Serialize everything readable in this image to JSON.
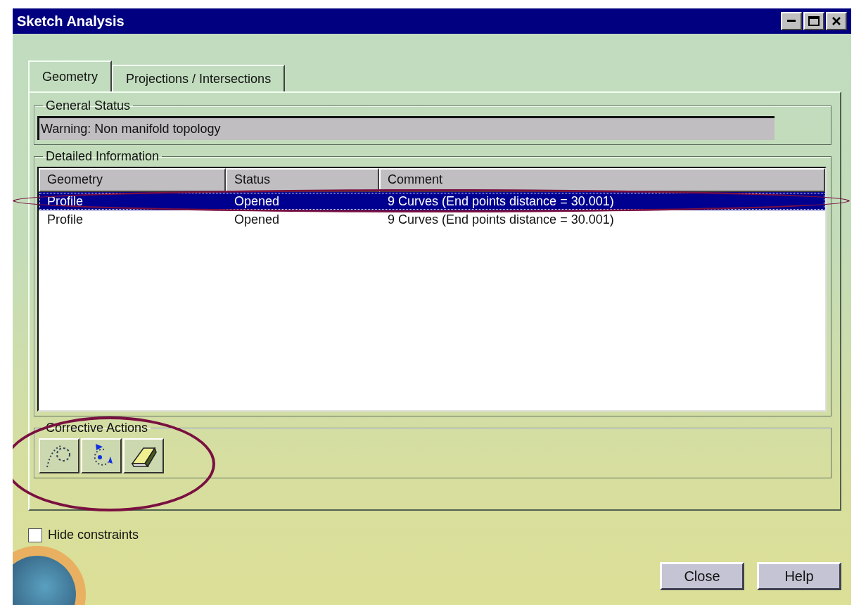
{
  "window": {
    "title": "Sketch Analysis"
  },
  "tabs": [
    {
      "label": "Geometry",
      "selected": true
    },
    {
      "label": "Projections / Intersections",
      "selected": false
    }
  ],
  "general_status": {
    "label": "General Status",
    "value": "Warning: Non manifold topology"
  },
  "detailed_information": {
    "label": "Detailed Information",
    "columns": [
      "Geometry",
      "Status",
      "Comment"
    ],
    "rows": [
      {
        "cells": [
          "Profile",
          "Opened",
          "9 Curves (End points distance = 30.001)"
        ],
        "selected": true
      },
      {
        "cells": [
          "Profile",
          "Opened",
          "9 Curves (End points distance = 30.001)"
        ],
        "selected": false
      }
    ]
  },
  "corrective_actions": {
    "label": "Corrective Actions",
    "tools": [
      {
        "kind": "construction"
      },
      {
        "kind": "rotate"
      },
      {
        "kind": "erase"
      }
    ]
  },
  "hide_constraints": {
    "label": "Hide constraints",
    "checked": false
  },
  "buttons": [
    "Close",
    "Help"
  ]
}
